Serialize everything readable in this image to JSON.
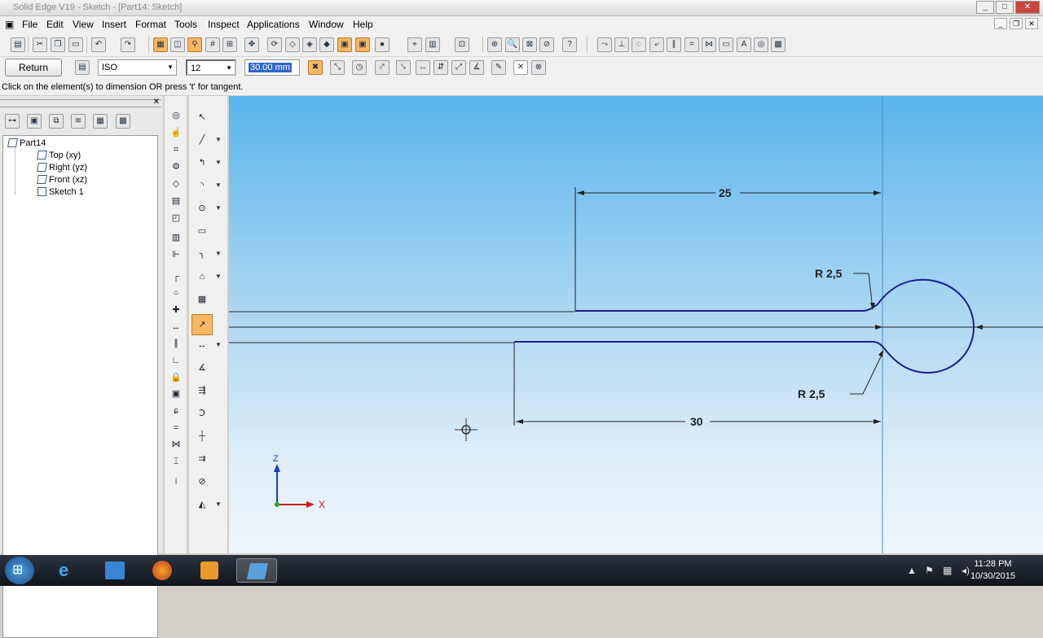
{
  "window": {
    "title": "Solid Edge V19 - Sketch - [Part14: Sketch]"
  },
  "menu": [
    "File",
    "Edit",
    "View",
    "Insert",
    "Format",
    "Tools",
    "Inspect",
    "Applications",
    "Window",
    "Help"
  ],
  "ribbon": {
    "return_label": "Return",
    "style_value": "ISO",
    "font_size_value": "12",
    "dimension_value": "30.00 mm"
  },
  "prompt": "Click on the element(s) to dimension OR press 't' for tangent.",
  "tree": {
    "root": "Part14",
    "items": [
      "Top (xy)",
      "Right (yz)",
      "Front (xz)",
      "Sketch 1"
    ]
  },
  "dimensions": {
    "top_length": "25",
    "bottom_length": "30",
    "radius_top": "R 2,5",
    "radius_bottom": "R 2,5"
  },
  "triad": {
    "z": "Z",
    "x": "X"
  },
  "clock": {
    "time": "11:28 PM",
    "date": "10/30/2015"
  },
  "colors": {
    "accent": "#f6b865",
    "geometry": "#1e1e8c",
    "canvas_top": "#59b4ec"
  }
}
